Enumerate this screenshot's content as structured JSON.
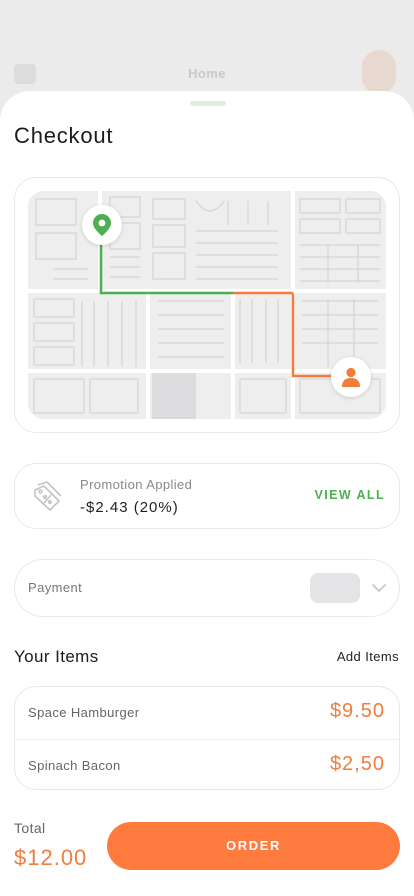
{
  "background": {
    "title": "Home"
  },
  "sheet": {
    "title": "Checkout"
  },
  "map": {
    "route_colors": {
      "start": "#4caf50",
      "end": "#f07d3c"
    }
  },
  "promotion": {
    "label": "Promotion Applied",
    "value": "-$2.43 (20%)",
    "action": "VIEW ALL"
  },
  "payment": {
    "label": "Payment"
  },
  "items": {
    "heading": "Your Items",
    "add_label": "Add Items",
    "list": [
      {
        "name": "Space Hamburger",
        "price": "$9.50"
      },
      {
        "name": "Spinach Bacon",
        "price": "$2,50"
      }
    ]
  },
  "footer": {
    "total_label": "Total",
    "total_value": "$12.00",
    "order_label": "ORDER"
  },
  "colors": {
    "accent": "#ff7a3d",
    "price": "#f07d3c",
    "success": "#4caf50"
  }
}
